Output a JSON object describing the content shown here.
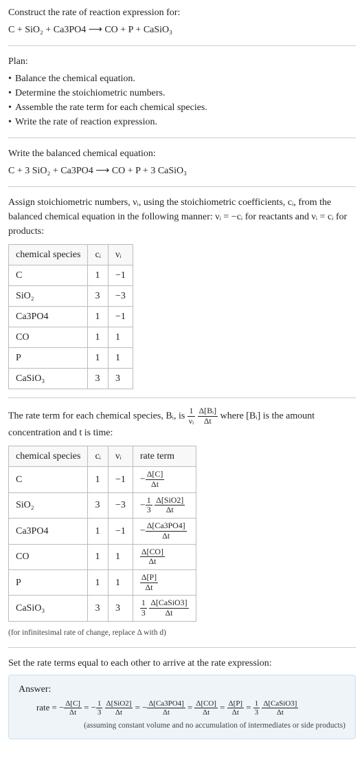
{
  "title": "Construct the rate of reaction expression for:",
  "equation_unbalanced": "C + SiO₂ + Ca3PO4  ⟶  CO + P + CaSiO₃",
  "plan_label": "Plan:",
  "plan_items": [
    "Balance the chemical equation.",
    "Determine the stoichiometric numbers.",
    "Assemble the rate term for each chemical species.",
    "Write the rate of reaction expression."
  ],
  "balanced_label": "Write the balanced chemical equation:",
  "equation_balanced": "C + 3 SiO₂ + Ca3PO4  ⟶  CO + P + 3 CaSiO₃",
  "assign_text": "Assign stoichiometric numbers, νᵢ, using the stoichiometric coefficients, cᵢ, from the balanced chemical equation in the following manner: νᵢ = −cᵢ for reactants and νᵢ = cᵢ for products:",
  "table1": {
    "headers": [
      "chemical species",
      "cᵢ",
      "νᵢ"
    ],
    "rows": [
      [
        "C",
        "1",
        "−1"
      ],
      [
        "SiO₂",
        "3",
        "−3"
      ],
      [
        "Ca3PO4",
        "1",
        "−1"
      ],
      [
        "CO",
        "1",
        "1"
      ],
      [
        "P",
        "1",
        "1"
      ],
      [
        "CaSiO₃",
        "3",
        "3"
      ]
    ]
  },
  "rate_term_intro_a": "The rate term for each chemical species, Bᵢ, is ",
  "rate_term_intro_b": " where [Bᵢ] is the amount concentration and t is time:",
  "frac_main": {
    "num_a": "1",
    "den_a": "νᵢ",
    "num_b": "Δ[Bᵢ]",
    "den_b": "Δt"
  },
  "table2": {
    "headers": [
      "chemical species",
      "cᵢ",
      "νᵢ",
      "rate term"
    ],
    "rows": [
      {
        "sp": "C",
        "c": "1",
        "v": "−1",
        "neg": "−",
        "pre": "",
        "num": "Δ[C]",
        "den": "Δt"
      },
      {
        "sp": "SiO₂",
        "c": "3",
        "v": "−3",
        "neg": "−",
        "pre": "1/3",
        "num": "Δ[SiO2]",
        "den": "Δt"
      },
      {
        "sp": "Ca3PO4",
        "c": "1",
        "v": "−1",
        "neg": "−",
        "pre": "",
        "num": "Δ[Ca3PO4]",
        "den": "Δt"
      },
      {
        "sp": "CO",
        "c": "1",
        "v": "1",
        "neg": "",
        "pre": "",
        "num": "Δ[CO]",
        "den": "Δt"
      },
      {
        "sp": "P",
        "c": "1",
        "v": "1",
        "neg": "",
        "pre": "",
        "num": "Δ[P]",
        "den": "Δt"
      },
      {
        "sp": "CaSiO₃",
        "c": "3",
        "v": "3",
        "neg": "",
        "pre": "1/3",
        "num": "Δ[CaSiO3]",
        "den": "Δt"
      }
    ]
  },
  "infinitesimal_note": "(for infinitesimal rate of change, replace Δ with d)",
  "set_equal_text": "Set the rate terms equal to each other to arrive at the rate expression:",
  "answer_label": "Answer:",
  "answer_prefix": "rate = ",
  "answer_terms": [
    {
      "neg": "−",
      "pre": "",
      "num": "Δ[C]",
      "den": "Δt"
    },
    {
      "neg": "−",
      "pre": "1/3",
      "num": "Δ[SiO2]",
      "den": "Δt"
    },
    {
      "neg": "−",
      "pre": "",
      "num": "Δ[Ca3PO4]",
      "den": "Δt"
    },
    {
      "neg": "",
      "pre": "",
      "num": "Δ[CO]",
      "den": "Δt"
    },
    {
      "neg": "",
      "pre": "",
      "num": "Δ[P]",
      "den": "Δt"
    },
    {
      "neg": "",
      "pre": "1/3",
      "num": "Δ[CaSiO3]",
      "den": "Δt"
    }
  ],
  "answer_note": "(assuming constant volume and no accumulation of intermediates or side products)"
}
